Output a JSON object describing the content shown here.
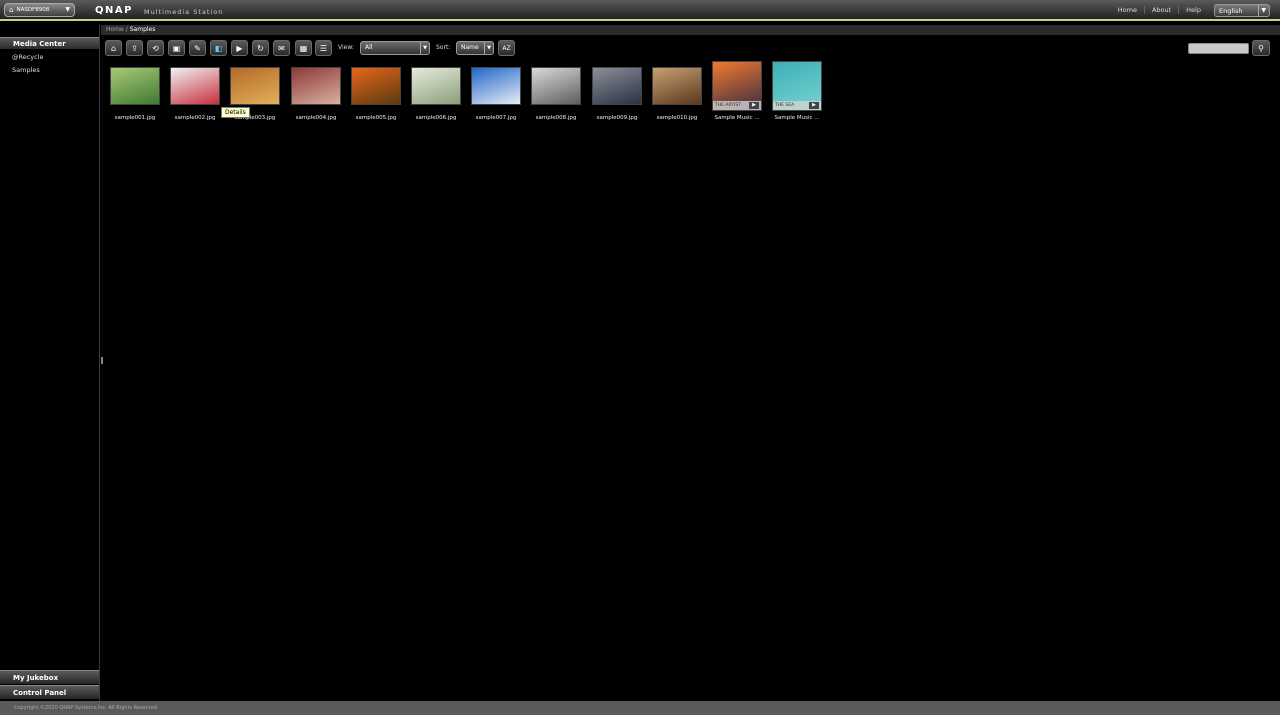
{
  "topbar": {
    "nas_name": "NASDF8908",
    "logo": "QNAP",
    "logo_sub": "Multimedia Station",
    "links": [
      "Home",
      "About",
      "Help"
    ],
    "language": "English"
  },
  "breadcrumb": {
    "home": "Home",
    "separator": "/",
    "current": "Samples"
  },
  "sidebar": {
    "header": "Media Center",
    "items": [
      "@Recycle",
      "Samples"
    ],
    "footer": [
      "My Jukebox",
      "Control Panel"
    ]
  },
  "toolbar": {
    "view_label": "View:",
    "view_value": "All",
    "sort_label": "Sort:",
    "sort_value": "Name",
    "sort_order_icon": "AZ"
  },
  "tooltip": "Details",
  "files": [
    {
      "name": "sample001.jpg",
      "type": "image",
      "colors": [
        "#a9c97a",
        "#3f7a2e"
      ]
    },
    {
      "name": "sample002.jpg",
      "type": "image",
      "colors": [
        "#f0f0f0",
        "#c73040"
      ]
    },
    {
      "name": "sample003.jpg",
      "type": "image",
      "colors": [
        "#b46a2a",
        "#e2b05a"
      ]
    },
    {
      "name": "sample004.jpg",
      "type": "image",
      "colors": [
        "#8c3a3a",
        "#d9b0a0"
      ]
    },
    {
      "name": "sample005.jpg",
      "type": "image",
      "colors": [
        "#e8661c",
        "#5a3a10"
      ]
    },
    {
      "name": "sample006.jpg",
      "type": "image",
      "colors": [
        "#e6eadc",
        "#8aa07a"
      ]
    },
    {
      "name": "sample007.jpg",
      "type": "image",
      "colors": [
        "#1f66c8",
        "#e8eef6"
      ]
    },
    {
      "name": "sample008.jpg",
      "type": "image",
      "colors": [
        "#d9d9d9",
        "#5e5e5e"
      ]
    },
    {
      "name": "sample009.jpg",
      "type": "image",
      "colors": [
        "#8a8f9a",
        "#2c3040"
      ]
    },
    {
      "name": "sample010.jpg",
      "type": "image",
      "colors": [
        "#c8a070",
        "#5a3820"
      ]
    },
    {
      "name": "Sample Music ...",
      "type": "music",
      "banner": "THE ARTIST",
      "colors": [
        "#f07a30",
        "#3a2a40"
      ]
    },
    {
      "name": "Sample Music ...",
      "type": "music",
      "banner": "THE SEA",
      "colors": [
        "#3ab0b8",
        "#7ad2d0"
      ]
    }
  ],
  "footer": "Copyright ©2010 QNAP Systems,Inc. All Rights Reserved."
}
